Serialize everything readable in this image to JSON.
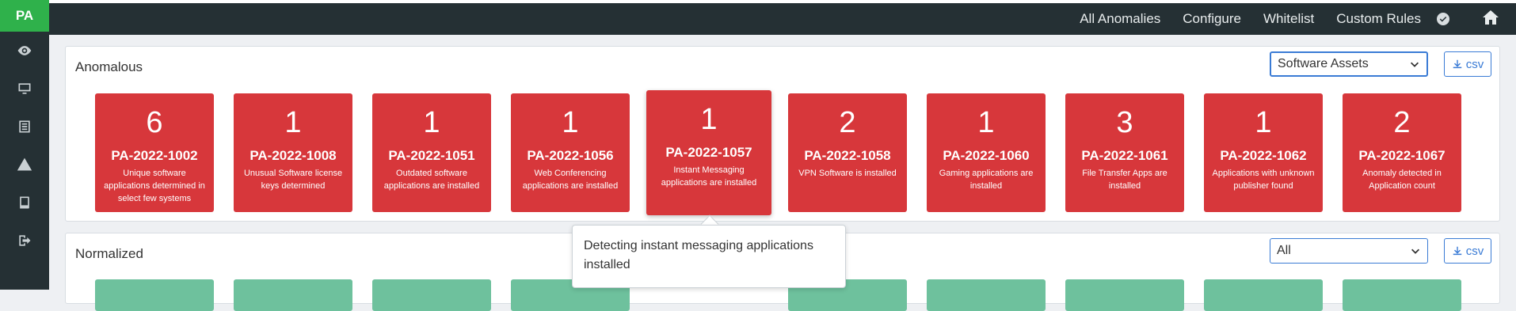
{
  "sidebar": {
    "logo": "PA",
    "items": [
      {
        "icon": "eye-icon"
      },
      {
        "icon": "monitor-icon"
      },
      {
        "icon": "list-icon"
      },
      {
        "icon": "warning-icon"
      },
      {
        "icon": "book-icon"
      },
      {
        "icon": "logout-icon"
      }
    ]
  },
  "topnav": {
    "links": [
      "All Anomalies",
      "Configure",
      "Whitelist",
      "Custom Rules"
    ],
    "check_icon": "check-circle-icon",
    "home_icon": "home-icon"
  },
  "anomalous": {
    "title": "Anomalous",
    "filter_value": "Software Assets",
    "csv_label": "csv",
    "cards": [
      {
        "count": "6",
        "id": "PA-2022-1002",
        "desc": "Unique software applications determined in select few systems"
      },
      {
        "count": "1",
        "id": "PA-2022-1008",
        "desc": "Unusual Software license keys determined"
      },
      {
        "count": "1",
        "id": "PA-2022-1051",
        "desc": "Outdated software applications are installed"
      },
      {
        "count": "1",
        "id": "PA-2022-1056",
        "desc": "Web Conferencing applications are installed"
      },
      {
        "count": "1",
        "id": "PA-2022-1057",
        "desc": "Instant Messaging applications are installed"
      },
      {
        "count": "2",
        "id": "PA-2022-1058",
        "desc": "VPN Software is installed"
      },
      {
        "count": "1",
        "id": "PA-2022-1060",
        "desc": "Gaming applications are installed"
      },
      {
        "count": "3",
        "id": "PA-2022-1061",
        "desc": "File Transfer Apps are installed"
      },
      {
        "count": "1",
        "id": "PA-2022-1062",
        "desc": "Applications with unknown publisher found"
      },
      {
        "count": "2",
        "id": "PA-2022-1067",
        "desc": "Anomaly detected in Application count"
      }
    ]
  },
  "normalized": {
    "title": "Normalized",
    "filter_value": "All",
    "csv_label": "csv"
  },
  "tooltip": {
    "text": "Detecting instant messaging applications installed"
  },
  "colors": {
    "anomaly_card": "#d7373b",
    "normal_card": "#6ec19d",
    "accent": "#3a7bd5",
    "nav_bg": "#253034",
    "logo_bg": "#2fb14b"
  }
}
